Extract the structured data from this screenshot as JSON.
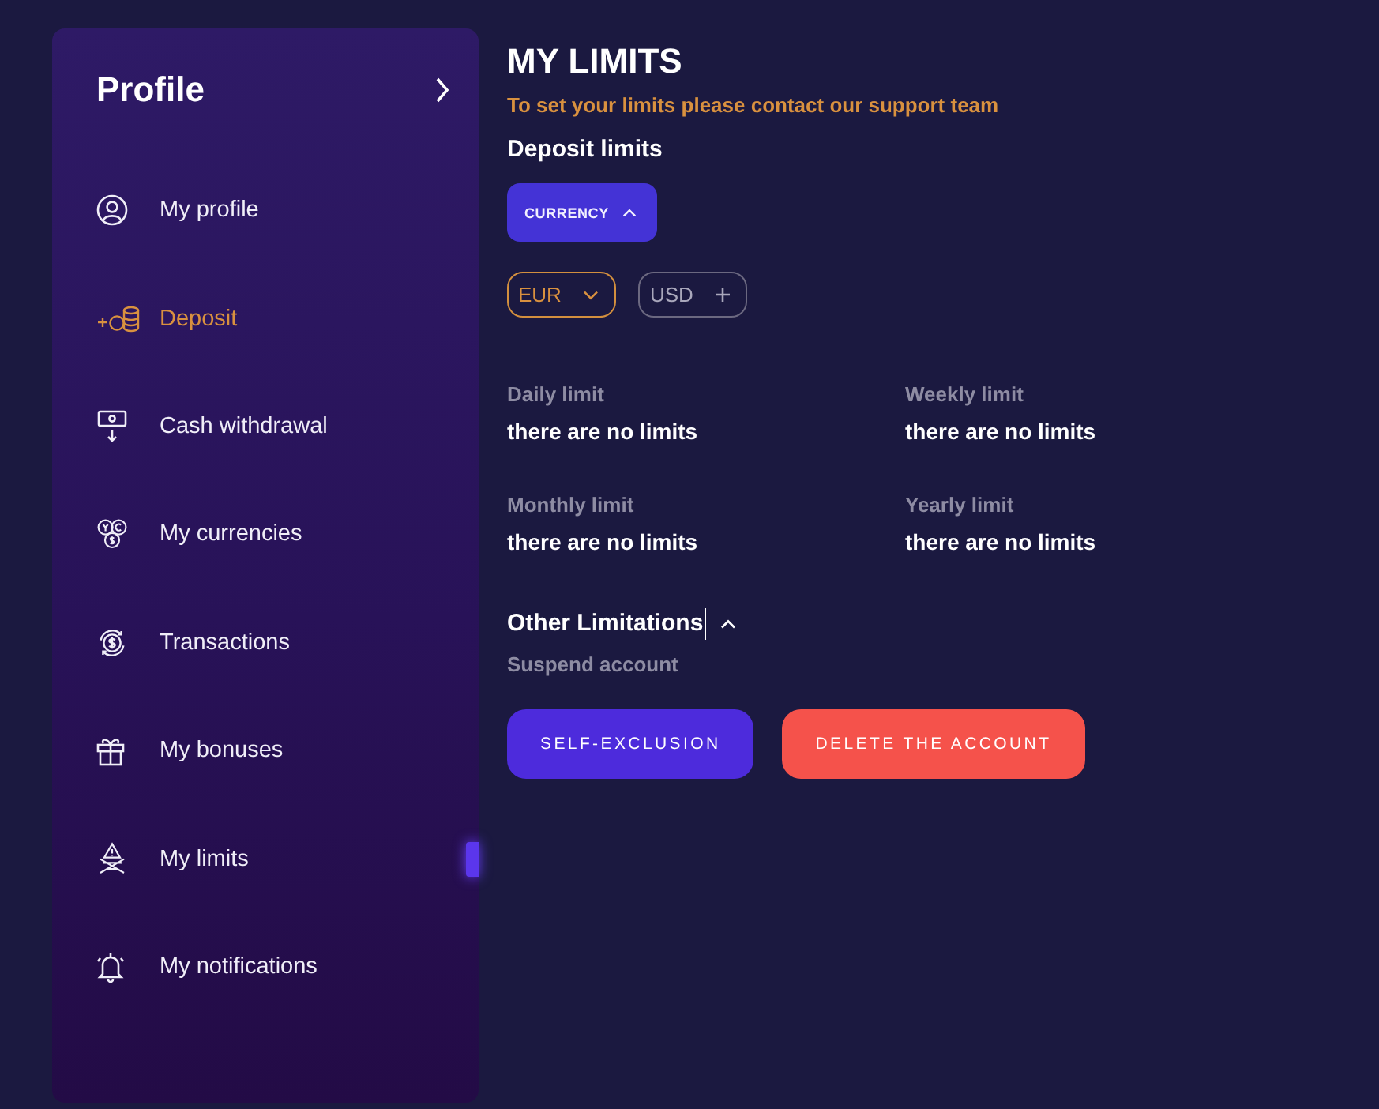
{
  "sidebar": {
    "title": "Profile",
    "items": [
      {
        "label": "My profile",
        "selected": false,
        "highlighted": false
      },
      {
        "label": "Deposit",
        "selected": false,
        "highlighted": true
      },
      {
        "label": "Cash withdrawal",
        "selected": false,
        "highlighted": false
      },
      {
        "label": "My currencies",
        "selected": false,
        "highlighted": false
      },
      {
        "label": "Transactions",
        "selected": false,
        "highlighted": false
      },
      {
        "label": "My bonuses",
        "selected": false,
        "highlighted": false
      },
      {
        "label": "My limits",
        "selected": true,
        "highlighted": false
      },
      {
        "label": "My notifications",
        "selected": false,
        "highlighted": false
      }
    ]
  },
  "main": {
    "title": "MY LIMITS",
    "notice": "To set your limits please contact our support team",
    "section_title": "Deposit limits",
    "currency_toggle": {
      "label": "CURRENCY",
      "expanded": true
    },
    "currencies": [
      {
        "label": "EUR",
        "selected": true
      },
      {
        "label": "USD",
        "selected": false
      }
    ],
    "limits": [
      {
        "label": "Daily limit",
        "value": "there are no limits"
      },
      {
        "label": "Weekly limit",
        "value": "there are no limits"
      },
      {
        "label": "Monthly limit",
        "value": "there are no limits"
      },
      {
        "label": "Yearly limit",
        "value": "there are no limits"
      }
    ],
    "other_limitations": {
      "title": "Other Limitations",
      "expanded": true,
      "subtitle": "Suspend account",
      "buttons": [
        {
          "label": "SELF-EXCLUSION",
          "kind": "primary"
        },
        {
          "label": "DELETE THE ACCOUNT",
          "kind": "danger"
        }
      ]
    }
  }
}
